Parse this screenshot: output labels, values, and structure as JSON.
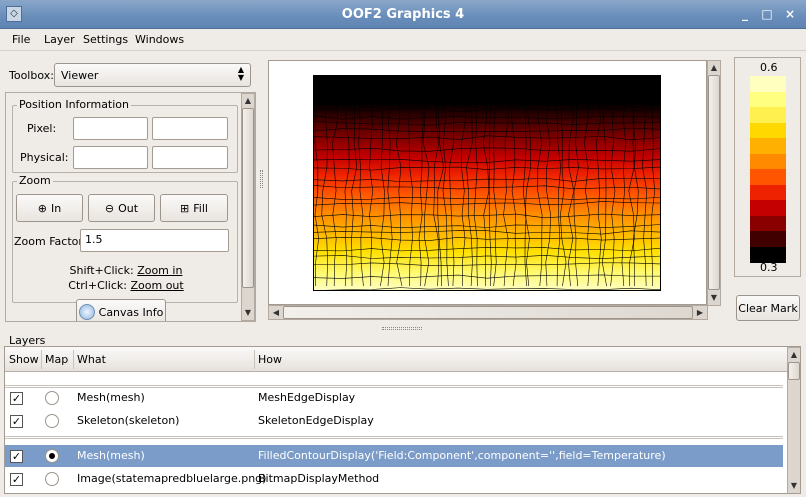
{
  "window": {
    "title": "OOF2 Graphics 4",
    "minimize": "_",
    "maximize": "□",
    "close": "×"
  },
  "menubar": [
    "File",
    "Layer",
    "Settings",
    "Windows"
  ],
  "toolbox": {
    "label": "Toolbox:",
    "value": "Viewer"
  },
  "position": {
    "title": "Position Information",
    "pixel_label": "Pixel:",
    "physical_label": "Physical:",
    "pixel_x": "",
    "pixel_y": "",
    "physical_x": "",
    "physical_y": ""
  },
  "zoom": {
    "title": "Zoom",
    "in": "In",
    "out": "Out",
    "fill": "Fill",
    "factor_label": "Zoom Factor:",
    "factor_value": "1.5",
    "shift_prefix": "Shift+Click: ",
    "shift_link": "Zoom in",
    "ctrl_prefix": "Ctrl+Click: ",
    "ctrl_link": "Zoom out"
  },
  "canvas_info": "Canvas Info",
  "legend": {
    "max": "0.6",
    "min": "0.3",
    "clear_mark": "Clear Mark",
    "colors": [
      "#ffffc0",
      "#ffff80",
      "#fff050",
      "#ffd800",
      "#ffb000",
      "#ff8a00",
      "#ff5500",
      "#ee2200",
      "#c40000",
      "#8a0000",
      "#400000",
      "#000000"
    ]
  },
  "layers": {
    "title": "Layers",
    "headers": {
      "show": "Show",
      "map": "Map",
      "what": "What",
      "how": "How"
    },
    "rows": [
      {
        "show": true,
        "map": false,
        "what": "Mesh(mesh)",
        "how": "MeshEdgeDisplay",
        "selected": false
      },
      {
        "show": true,
        "map": false,
        "what": "Skeleton(skeleton)",
        "how": "SkeletonEdgeDisplay",
        "selected": false
      },
      {
        "show": true,
        "map": true,
        "what": "Mesh(mesh)",
        "how": "FilledContourDisplay('Field:Component',component='',field=Temperature)",
        "selected": true
      },
      {
        "show": true,
        "map": false,
        "what": "Image(statemapredbluelarge.png)",
        "how": "BitmapDisplayMethod",
        "selected": false
      }
    ]
  }
}
